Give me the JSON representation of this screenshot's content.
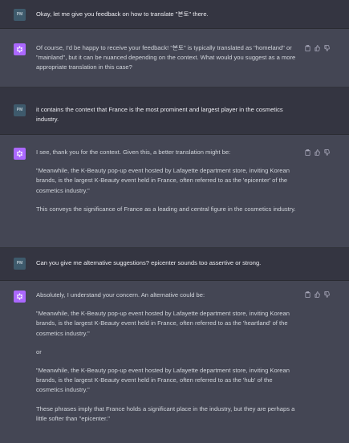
{
  "user_avatar_initials": "PM",
  "messages": [
    {
      "role": "user",
      "paragraphs": [
        "Okay, let me give you feedback on how to translate \"본토\" there."
      ]
    },
    {
      "role": "assistant",
      "paragraphs": [
        "Of course, I'd be happy to receive your feedback! \"본토\" is typically translated as \"homeland\" or \"mainland\", but it can be nuanced depending on the context. What would you suggest as a more appropriate translation in this case?"
      ]
    },
    {
      "role": "user",
      "paragraphs": [
        "it contains the context that France is the most prominent and largest player in the cosmetics industry."
      ]
    },
    {
      "role": "assistant",
      "paragraphs": [
        "I see, thank you for the context. Given this, a better translation might be:",
        "\"Meanwhile, the K-Beauty pop-up event hosted by Lafayette department store, inviting Korean brands, is the largest K-Beauty event held in France, often referred to as the 'epicenter' of the cosmetics industry.\"",
        "This conveys the significance of France as a leading and central figure in the cosmetics industry."
      ]
    },
    {
      "role": "user",
      "paragraphs": [
        "Can you give me alternative suggestions? epicenter sounds too assertive or strong."
      ]
    },
    {
      "role": "assistant",
      "paragraphs": [
        "Absolutely, I understand your concern. An alternative could be:",
        "\"Meanwhile, the K-Beauty pop-up event hosted by Lafayette department store, inviting Korean brands, is the largest K-Beauty event held in France, often referred to as the 'heartland' of the cosmetics industry.\"",
        "or",
        "\"Meanwhile, the K-Beauty pop-up event hosted by Lafayette department store, inviting Korean brands, is the largest K-Beauty event held in France, often referred to as the 'hub' of the cosmetics industry.\"",
        "These phrases imply that France holds a significant place in the industry, but they are perhaps a little softer than \"epicenter.\""
      ]
    }
  ],
  "icons": {
    "copy": "clipboard-icon",
    "like": "thumbs-up-icon",
    "dislike": "thumbs-down-icon",
    "bot": "openai-logo-icon"
  },
  "colors": {
    "user_bg": "#343541",
    "assistant_bg": "#444654",
    "bot_avatar": "#ab68ff",
    "user_avatar": "#3e5a6c",
    "text": "#d1d5db"
  }
}
